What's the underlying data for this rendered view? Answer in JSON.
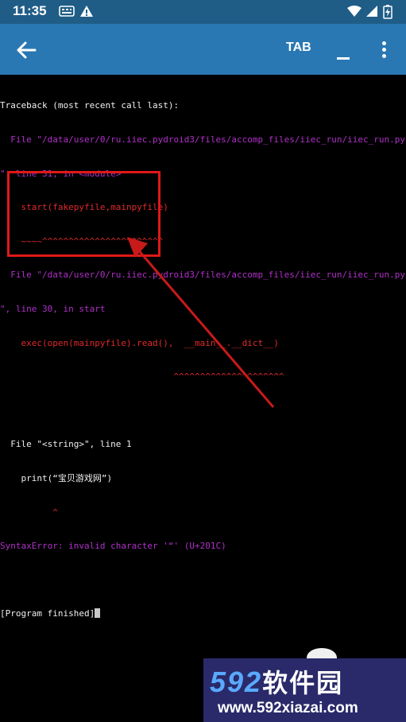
{
  "status_bar": {
    "time": "11:35",
    "icons": [
      "notification-icon",
      "warning-icon",
      "wifi-icon",
      "signal-icon",
      "battery-icon"
    ]
  },
  "app_bar": {
    "back_icon": "arrow-left-icon",
    "tab_label": "TAB",
    "minimize_label": "_",
    "menu_icon": "more-vert-icon"
  },
  "terminal": {
    "lines": [
      "Traceback (most recent call last):",
      "  File \"/data/user/0/ru.iiec.pydroid3/files/accomp_files/iiec_run/iiec_run.py",
      "\", line 31, in <module>",
      "    start(fakepyfile,mainpyfile)",
      "    ~~~~^^^^^^^^^^^^^^^^^^^^^^^",
      "  File \"/data/user/0/ru.iiec.pydroid3/files/accomp_files/iiec_run/iiec_run.py",
      "\", line 30, in start",
      "    exec(open(mainpyfile).read(),  __main__.__dict__)",
      "                                 ^^^^^^^^^^^^^^^^^^^^^",
      "",
      "  File \"<string>\", line 1",
      "    print(“宝贝游戏网”)",
      "          ^",
      "SyntaxError: invalid character '“' (U+201C)",
      "",
      "[Program finished]"
    ]
  },
  "watermark": {
    "brand_number": "592",
    "brand_cn": "软件园",
    "site": "www.592xiazai.com"
  },
  "colors": {
    "status_bar": "#1f5d87",
    "app_bar": "#2a78b3",
    "terminal_bg": "#000000",
    "magenta": "#b030c8",
    "red": "#e02a2a",
    "annotation_red": "#e01818"
  }
}
